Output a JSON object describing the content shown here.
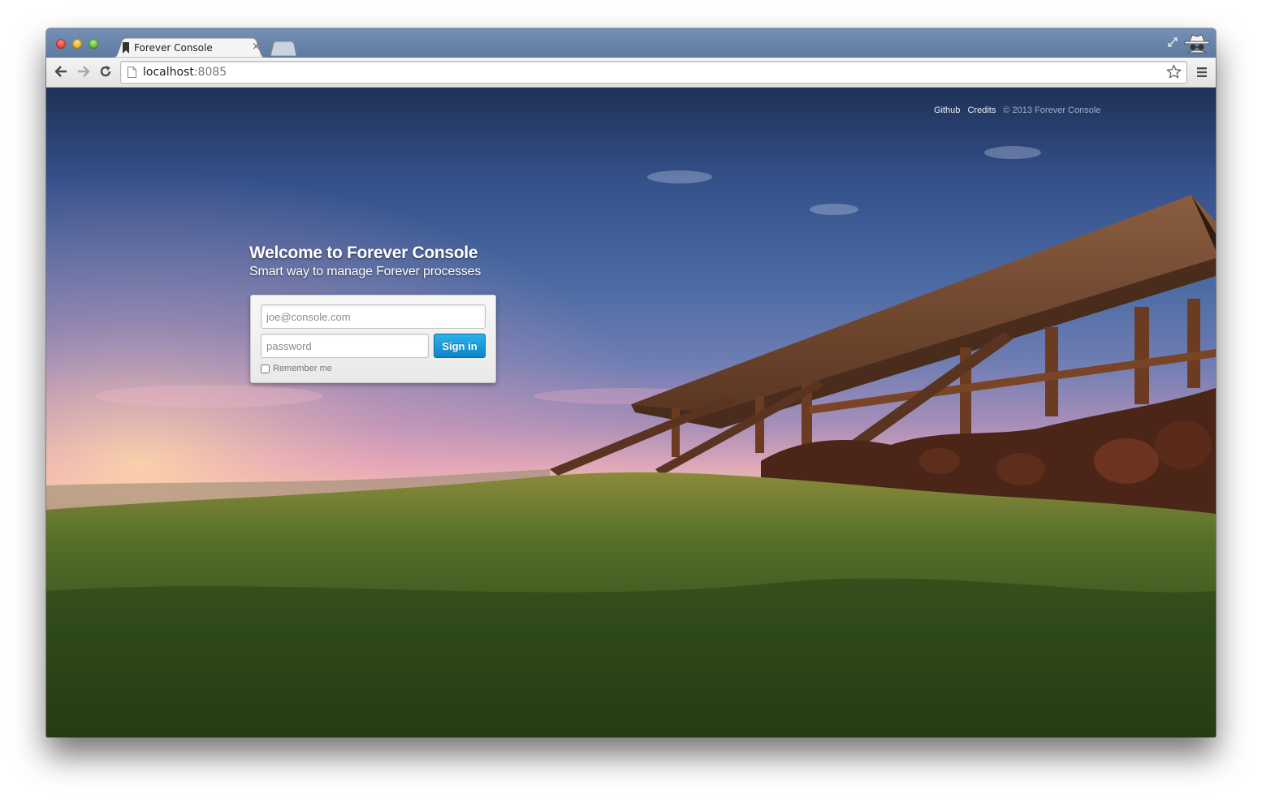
{
  "browser": {
    "tab": {
      "title": "Forever Console",
      "close_label": "×"
    },
    "address_bar": {
      "host": "localhost",
      "port": ":8085"
    }
  },
  "header_links": {
    "github": "Github",
    "credits": "Credits",
    "copyright": "© 2013 Forever Console"
  },
  "hero": {
    "title": "Welcome to Forever Console",
    "subtitle": "Smart way to manage Forever processes"
  },
  "login": {
    "email_placeholder": "joe@console.com",
    "email_value": "",
    "password_placeholder": "password",
    "password_value": "",
    "signin_label": "Sign in",
    "remember_label": "Remember me",
    "remember_checked": false
  },
  "icons": {
    "back": "arrow-left-icon",
    "forward": "arrow-right-icon",
    "reload": "reload-icon",
    "page": "page-icon",
    "bookmark": "star-icon",
    "menu": "hamburger-menu-icon",
    "fullscreen": "fullscreen-icon",
    "incognito": "incognito-icon",
    "favicon": "bookmark-favicon-icon"
  },
  "colors": {
    "signin_button": "#1a9ad8",
    "tabstrip": "#6c88ad"
  }
}
